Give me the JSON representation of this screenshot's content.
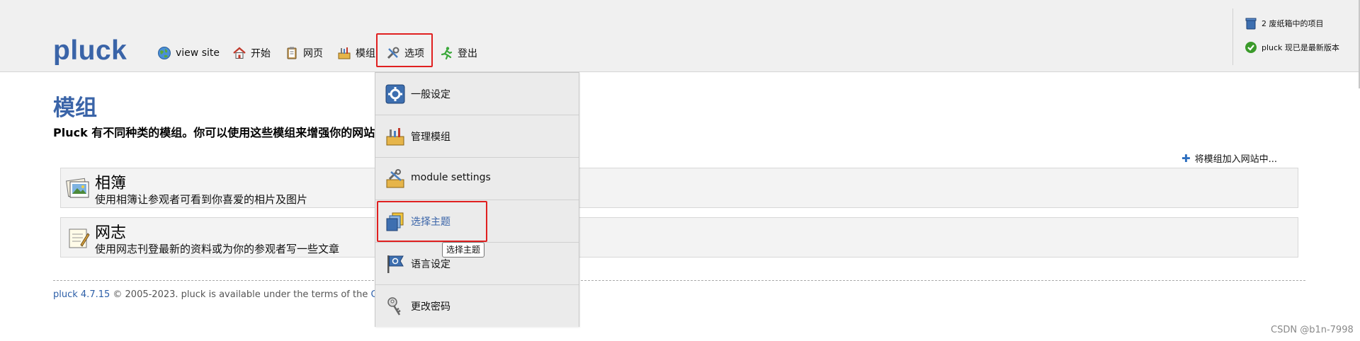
{
  "header": {
    "logo": "pluck",
    "nav": [
      {
        "label": "view site",
        "icon": "globe-icon"
      },
      {
        "label": "开始",
        "icon": "home-icon"
      },
      {
        "label": "网页",
        "icon": "clipboard-icon"
      },
      {
        "label": "模组",
        "icon": "toolbox-icon"
      },
      {
        "label": "选项",
        "icon": "tools-icon"
      },
      {
        "label": "登出",
        "icon": "running-man-icon"
      }
    ],
    "trash_notice": "2 废纸箱中的项目",
    "version_notice": "pluck 现已是最新版本"
  },
  "main": {
    "title": "模组",
    "description": "Pluck 有不同种类的模组。你可以使用这些模组来增强你的网站",
    "add_module": "将模组加入网站中...",
    "modules": [
      {
        "name": "相簿",
        "description": "使用相簿让参观者可看到你喜爱的相片及图片",
        "icon": "album-icon"
      },
      {
        "name": "网志",
        "description": "使用网志刊登最新的资料或为你的参观者写一些文章",
        "icon": "blog-icon"
      }
    ]
  },
  "footer": {
    "version_link": "pluck 4.7.15",
    "text": " © 2005-2023. pluck is available under the terms of the ",
    "license_link": "GNU"
  },
  "dropdown": {
    "items": [
      {
        "label": "一般设定",
        "icon": "settings-icon"
      },
      {
        "label": "管理模组",
        "icon": "manage-modules-icon"
      },
      {
        "label": "module settings",
        "icon": "module-settings-icon"
      },
      {
        "label": "选择主题",
        "icon": "theme-icon",
        "active": true
      },
      {
        "label": "语言设定",
        "icon": "language-flag-icon"
      },
      {
        "label": "更改密码",
        "icon": "key-icon"
      }
    ],
    "tooltip": "选择主题"
  },
  "watermark": "CSDN @b1n-7998",
  "colors": {
    "brand_blue": "#3a64a8",
    "highlight_red": "#e02020",
    "header_bg": "#f0f0f0"
  }
}
